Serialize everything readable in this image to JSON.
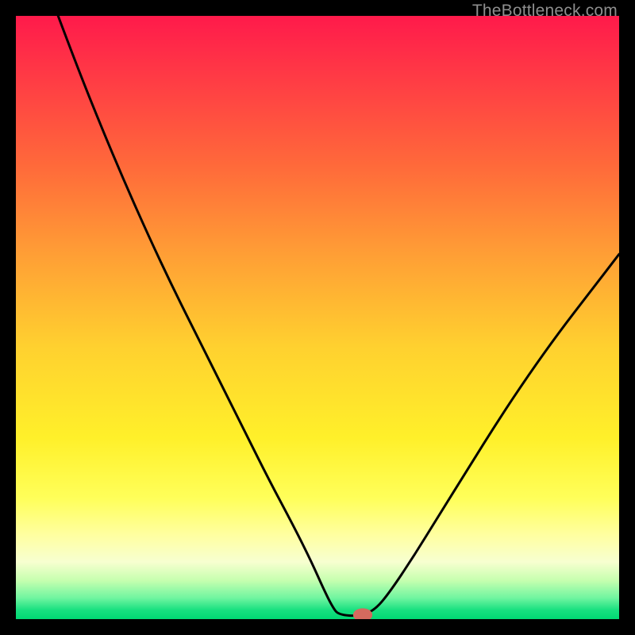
{
  "watermark": "TheBottleneck.com",
  "chart_data": {
    "type": "line",
    "title": "",
    "xlabel": "",
    "ylabel": "",
    "xlim": [
      0,
      100
    ],
    "ylim": [
      0,
      100
    ],
    "background_gradient": {
      "stops": [
        {
          "offset": 0.0,
          "color": "#ff1a4b"
        },
        {
          "offset": 0.1,
          "color": "#ff3a45"
        },
        {
          "offset": 0.25,
          "color": "#ff6a3a"
        },
        {
          "offset": 0.4,
          "color": "#ffa035"
        },
        {
          "offset": 0.55,
          "color": "#ffd12f"
        },
        {
          "offset": 0.7,
          "color": "#fff02a"
        },
        {
          "offset": 0.8,
          "color": "#ffff5a"
        },
        {
          "offset": 0.86,
          "color": "#ffffa0"
        },
        {
          "offset": 0.905,
          "color": "#f7ffd0"
        },
        {
          "offset": 0.935,
          "color": "#c8ffb0"
        },
        {
          "offset": 0.965,
          "color": "#70f5a0"
        },
        {
          "offset": 0.985,
          "color": "#18e080"
        },
        {
          "offset": 1.0,
          "color": "#00d873"
        }
      ]
    },
    "series": [
      {
        "name": "bottleneck-curve",
        "type": "line",
        "color": "#000000",
        "points": [
          {
            "x": 7.0,
            "y": 100.0
          },
          {
            "x": 10.0,
            "y": 92.0
          },
          {
            "x": 14.0,
            "y": 82.0
          },
          {
            "x": 18.0,
            "y": 72.5
          },
          {
            "x": 22.0,
            "y": 63.5
          },
          {
            "x": 26.0,
            "y": 55.0
          },
          {
            "x": 30.0,
            "y": 47.0
          },
          {
            "x": 34.0,
            "y": 39.0
          },
          {
            "x": 38.0,
            "y": 31.0
          },
          {
            "x": 42.0,
            "y": 23.0
          },
          {
            "x": 46.0,
            "y": 15.5
          },
          {
            "x": 49.0,
            "y": 9.5
          },
          {
            "x": 51.0,
            "y": 5.0
          },
          {
            "x": 52.5,
            "y": 2.0
          },
          {
            "x": 53.5,
            "y": 0.7
          },
          {
            "x": 57.0,
            "y": 0.5
          },
          {
            "x": 59.5,
            "y": 1.5
          },
          {
            "x": 62.0,
            "y": 4.5
          },
          {
            "x": 66.0,
            "y": 10.5
          },
          {
            "x": 70.0,
            "y": 17.0
          },
          {
            "x": 75.0,
            "y": 25.0
          },
          {
            "x": 80.0,
            "y": 33.0
          },
          {
            "x": 85.0,
            "y": 40.5
          },
          {
            "x": 90.0,
            "y": 47.5
          },
          {
            "x": 95.0,
            "y": 54.0
          },
          {
            "x": 100.0,
            "y": 60.5
          }
        ]
      }
    ],
    "marker": {
      "name": "optimal-point",
      "x": 57.5,
      "y": 0.7,
      "rx": 1.6,
      "ry": 1.1,
      "fill": "#d46a5e"
    }
  }
}
